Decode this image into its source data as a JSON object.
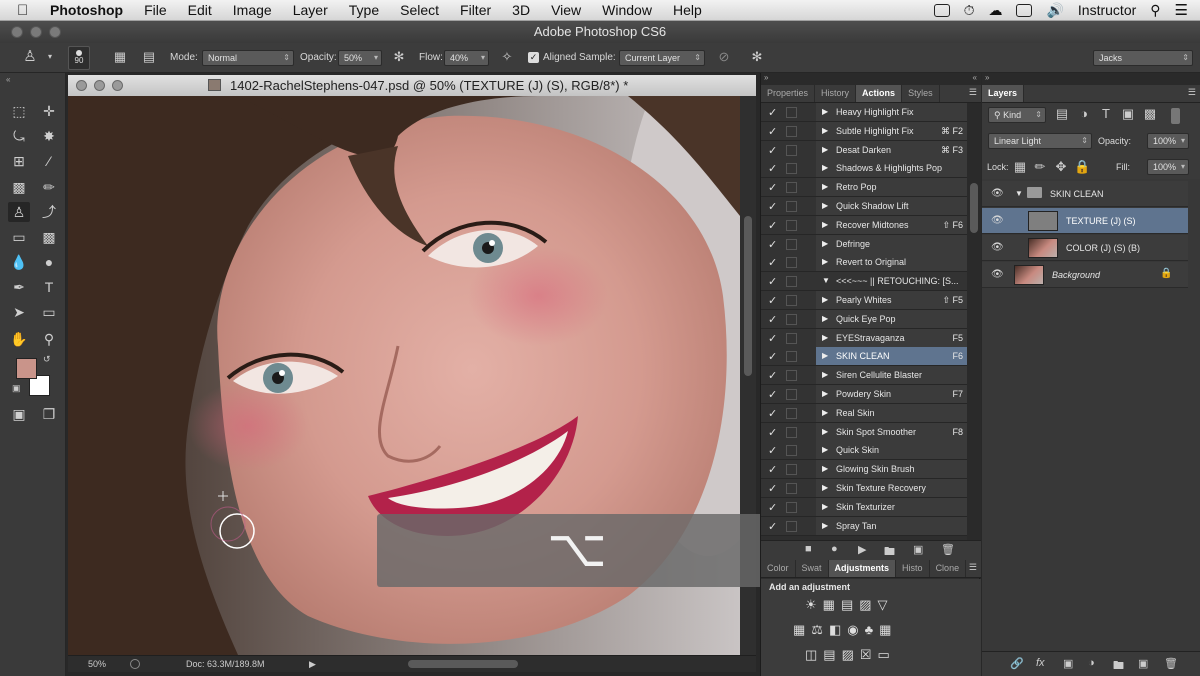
{
  "menubar": {
    "app_name": "Photoshop",
    "items": [
      "File",
      "Edit",
      "Image",
      "Layer",
      "Type",
      "Select",
      "Filter",
      "3D",
      "View",
      "Window",
      "Help"
    ],
    "user": "Instructor"
  },
  "window": {
    "title": "Adobe Photoshop CS6"
  },
  "options": {
    "brush_size": "90",
    "mode_label": "Mode:",
    "mode_value": "Normal",
    "opacity_label": "Opacity:",
    "opacity_value": "50%",
    "flow_label": "Flow:",
    "flow_value": "40%",
    "aligned_label": "Aligned",
    "aligned_checked": true,
    "sample_label": "Sample:",
    "sample_value": "Current Layer",
    "workspace_value": "Jacks"
  },
  "document": {
    "title": "1402-RachelStephens-047.psd @ 50% (TEXTURE (J) (S), RGB/8*) *",
    "zoom": "50%",
    "doc_size": "Doc: 63.3M/189.8M"
  },
  "overlay": {
    "glyph": "⌥"
  },
  "actions_panel": {
    "tabs": [
      "Properties",
      "History",
      "Actions",
      "Styles"
    ],
    "active_tab": "Actions",
    "items": [
      {
        "name": "Heavy Highlight Fix",
        "key": ""
      },
      {
        "name": "Subtle Highlight Fix",
        "key": "⌘ F2"
      },
      {
        "name": "Desat Darken",
        "key": "⌘ F3"
      },
      {
        "name": "Shadows & Highlights Pop",
        "key": ""
      },
      {
        "name": "Retro Pop",
        "key": ""
      },
      {
        "name": "Quick Shadow Lift",
        "key": ""
      },
      {
        "name": "Recover Midtones",
        "key": "⇧ F6"
      },
      {
        "name": "Defringe",
        "key": ""
      },
      {
        "name": "Revert to Original",
        "key": ""
      },
      {
        "name": "<<<~~~ || RETOUCHING: [S...",
        "key": "",
        "set": true
      },
      {
        "name": "Pearly Whites",
        "key": "⇧ F5"
      },
      {
        "name": "Quick Eye Pop",
        "key": ""
      },
      {
        "name": "EYEStravaganza",
        "key": "F5"
      },
      {
        "name": "SKIN CLEAN",
        "key": "F6",
        "selected": true
      },
      {
        "name": "Siren Cellulite Blaster",
        "key": ""
      },
      {
        "name": "Powdery Skin",
        "key": "F7"
      },
      {
        "name": "Real Skin",
        "key": ""
      },
      {
        "name": "Skin Spot Smoother",
        "key": "F8"
      },
      {
        "name": "Quick Skin",
        "key": ""
      },
      {
        "name": "Glowing Skin Brush",
        "key": ""
      },
      {
        "name": "Skin Texture Recovery",
        "key": ""
      },
      {
        "name": "Skin Texturizer",
        "key": ""
      },
      {
        "name": "Spray Tan",
        "key": ""
      }
    ]
  },
  "adjustments_panel": {
    "tabs": [
      "Color",
      "Swat",
      "Adjustments",
      "Histo",
      "Clone"
    ],
    "active_tab": "Adjustments",
    "heading": "Add an adjustment"
  },
  "layers_panel": {
    "tab": "Layers",
    "kind_label": "Kind",
    "blend_mode": "Linear Light",
    "opacity_label": "Opacity:",
    "opacity_value": "100%",
    "lock_label": "Lock:",
    "fill_label": "Fill:",
    "fill_value": "100%",
    "layers": [
      {
        "name": "SKIN CLEAN",
        "type": "group"
      },
      {
        "name": "TEXTURE (J) (S)",
        "type": "layer",
        "selected": true
      },
      {
        "name": "COLOR (J) (S) (B)",
        "type": "layer"
      },
      {
        "name": "Background",
        "type": "background"
      }
    ]
  },
  "colors": {
    "foreground": "#c9948a",
    "background": "#ffffff",
    "selection": "#5f748f"
  }
}
